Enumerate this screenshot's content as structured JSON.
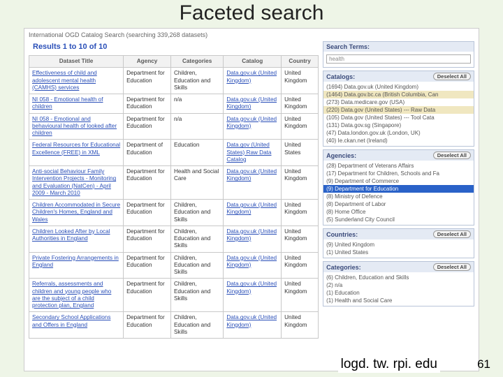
{
  "slide": {
    "title": "Faceted search",
    "url_footer": "logd. tw. rpi. edu",
    "page_number": "61"
  },
  "page_header": "International OGD Catalog Search (searching 339,268 datasets)",
  "results_header": "Results 1 to 10 of 10",
  "columns": [
    "Dataset Title",
    "Agency",
    "Categories",
    "Catalog",
    "Country"
  ],
  "rows": [
    {
      "title": "Effectiveness of child and adolescent mental health (CAMHS) services",
      "agency": "Department for Education",
      "categories": "Children, Education and Skills",
      "catalog": "Data.gov.uk (United Kingdom)",
      "country": "United Kingdom"
    },
    {
      "title": "NI 058 - Emotional health of children",
      "agency": "Department for Education",
      "categories": "n/a",
      "catalog": "Data.gov.uk (United Kingdom)",
      "country": "United Kingdom"
    },
    {
      "title": "NI 058 - Emotional and behavioural health of looked after children",
      "agency": "Department for Education",
      "categories": "n/a",
      "catalog": "Data.gov.uk (United Kingdom)",
      "country": "United Kingdom"
    },
    {
      "title": "Federal Resources for Educational Excellence (FREE) in XML",
      "agency": "Department of Education",
      "categories": "Education",
      "catalog": "Data.gov (United States) Raw Data Catalog",
      "country": "United States"
    },
    {
      "title": "Anti-social Behaviour Family Intervention Projects - Monitoring and Evaluation (NatCen) - April 2009 - March 2010",
      "agency": "Department for Education",
      "categories": "Health and Social Care",
      "catalog": "Data.gov.uk (United Kingdom)",
      "country": "United Kingdom"
    },
    {
      "title": "Children Accommodated in Secure Children's Homes, England and Wales",
      "agency": "Department for Education",
      "categories": "Children, Education and Skills",
      "catalog": "Data.gov.uk (United Kingdom)",
      "country": "United Kingdom"
    },
    {
      "title": "Children Looked After by Local Authorities in England",
      "agency": "Department for Education",
      "categories": "Children, Education and Skills",
      "catalog": "Data.gov.uk (United Kingdom)",
      "country": "United Kingdom"
    },
    {
      "title": "Private Fostering Arrangements in England",
      "agency": "Department for Education",
      "categories": "Children, Education and Skills",
      "catalog": "Data.gov.uk (United Kingdom)",
      "country": "United Kingdom"
    },
    {
      "title": "Referrals, assessments and children and young people who are the subject of a child protection plan, England",
      "agency": "Department for Education",
      "categories": "Children, Education and Skills",
      "catalog": "Data.gov.uk (United Kingdom)",
      "country": "United Kingdom"
    },
    {
      "title": "Secondary School Applications and Offers in England",
      "agency": "Department for Education",
      "categories": "Children, Education and Skills",
      "catalog": "Data.gov.uk (United Kingdom)",
      "country": "United Kingdom"
    }
  ],
  "facets": {
    "search_terms": {
      "label": "Search Terms:",
      "value": "health"
    },
    "catalogs": {
      "label": "Catalogs:",
      "deselect": "Deselect All",
      "items": [
        {
          "text": "(1694) Data.gov.uk (United Kingdom)",
          "sel": false
        },
        {
          "text": "(1464) Data.gov.bc.ca (British Columbia, Can",
          "sel": false,
          "hl": true
        },
        {
          "text": "(273) Data.medicare.gov (USA)",
          "sel": false
        },
        {
          "text": "(220) Data.gov (United States) --- Raw Data",
          "sel": false,
          "hl": true
        },
        {
          "text": "(105) Data.gov (United States) --- Tool Cata",
          "sel": false
        },
        {
          "text": "(131) Data.gov.sg (Singapore)",
          "sel": false
        },
        {
          "text": "(47) Data.london.gov.uk (London, UK)",
          "sel": false
        },
        {
          "text": "(40) Ie.ckan.net (Ireland)",
          "sel": false
        }
      ]
    },
    "agencies": {
      "label": "Agencies:",
      "deselect": "Deselect All",
      "items": [
        {
          "text": "(28) Department of Veterans Affairs",
          "sel": false
        },
        {
          "text": "(17) Department for Children, Schools and Fa",
          "sel": false
        },
        {
          "text": "(9) Department of Commerce",
          "sel": false
        },
        {
          "text": "(9) Department for Education",
          "sel": true
        },
        {
          "text": "(8) Ministry of Defence",
          "sel": false
        },
        {
          "text": "(8) Department of Labor",
          "sel": false
        },
        {
          "text": "(8) Home Office",
          "sel": false
        },
        {
          "text": "(5) Sunderland City Council",
          "sel": false
        }
      ]
    },
    "countries": {
      "label": "Countries:",
      "deselect": "Deselect All",
      "items": [
        {
          "text": "(9) United Kingdom",
          "sel": false
        },
        {
          "text": "(1) United States",
          "sel": false
        }
      ]
    },
    "categories": {
      "label": "Categories:",
      "deselect": "Deselect All",
      "items": [
        {
          "text": "(6) Children, Education and Skills",
          "sel": false
        },
        {
          "text": "(2) n/a",
          "sel": false
        },
        {
          "text": "(1) Education",
          "sel": false
        },
        {
          "text": "(1) Health and Social Care",
          "sel": false
        }
      ]
    }
  }
}
